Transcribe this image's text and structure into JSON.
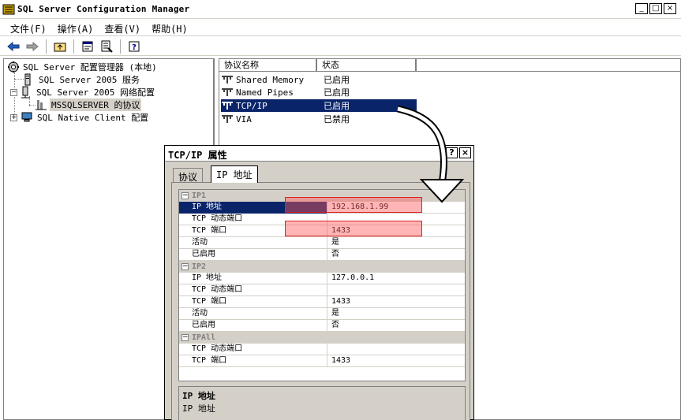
{
  "window": {
    "title": "SQL Server Configuration Manager",
    "controls": [
      "_",
      "□",
      "×"
    ]
  },
  "menu": [
    "文件(F)",
    "操作(A)",
    "查看(V)",
    "帮助(H)"
  ],
  "toolbar": [
    "back-icon",
    "forward-icon",
    "up-folder-icon",
    "properties-icon",
    "export-list-icon",
    "help-icon"
  ],
  "tree": {
    "root": "SQL Server 配置管理器 (本地)",
    "services": "SQL Server 2005 服务",
    "network": "SQL Server 2005 网络配置",
    "protocols": "MSSQLSERVER 的协议",
    "native": "SQL Native Client 配置"
  },
  "list": {
    "columns": [
      "协议名称",
      "状态"
    ],
    "rows": [
      {
        "name": "Shared Memory",
        "status": "已启用"
      },
      {
        "name": "Named Pipes",
        "status": "已启用"
      },
      {
        "name": "TCP/IP",
        "status": "已启用"
      },
      {
        "name": "VIA",
        "status": "已禁用"
      }
    ]
  },
  "dialog": {
    "title": "TCP/IP 属性",
    "help_btn": "?",
    "close_btn": "×",
    "tabs": [
      "协议",
      "IP 地址"
    ],
    "groups": [
      {
        "name": "IP1",
        "rows": [
          {
            "name": "IP 地址",
            "value": "192.168.1.99"
          },
          {
            "name": "TCP 动态端口",
            "value": ""
          },
          {
            "name": "TCP 端口",
            "value": "1433"
          },
          {
            "name": "活动",
            "value": "是"
          },
          {
            "name": "已启用",
            "value": "否"
          }
        ]
      },
      {
        "name": "IP2",
        "rows": [
          {
            "name": "IP 地址",
            "value": "127.0.0.1"
          },
          {
            "name": "TCP 动态端口",
            "value": ""
          },
          {
            "name": "TCP 端口",
            "value": "1433"
          },
          {
            "name": "活动",
            "value": "是"
          },
          {
            "name": "已启用",
            "value": "否"
          }
        ]
      },
      {
        "name": "IPAll",
        "rows": [
          {
            "name": "TCP 动态端口",
            "value": ""
          },
          {
            "name": "TCP 端口",
            "value": "1433"
          }
        ]
      }
    ],
    "description": {
      "title": "IP 地址",
      "text": "IP 地址"
    }
  },
  "colors": {
    "selection": "#0a246a",
    "highlight": "#ff5a5a",
    "chrome": "#d4d0c8"
  }
}
